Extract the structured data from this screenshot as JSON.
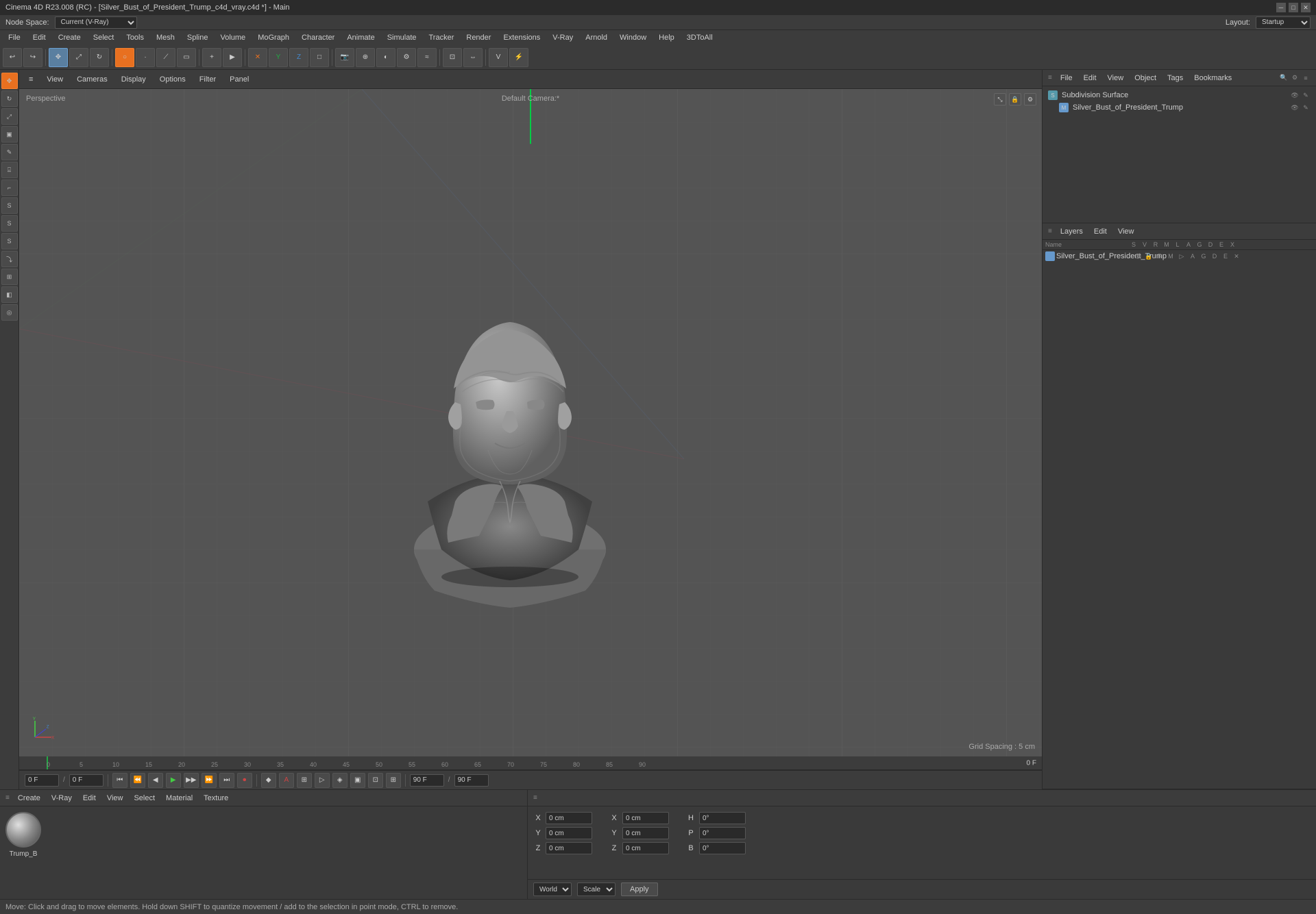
{
  "titlebar": {
    "title": "Cinema 4D R23.008 (RC) - [Silver_Bust_of_President_Trump_c4d_vray.c4d *] - Main",
    "minimize": "─",
    "maximize": "□",
    "close": "✕"
  },
  "menubar": {
    "items": [
      "File",
      "Edit",
      "Create",
      "Select",
      "Tools",
      "Mesh",
      "Spline",
      "Volume",
      "MoGraph",
      "Character",
      "Animate",
      "Simulate",
      "Tracker",
      "Render",
      "Extensions",
      "V-Ray",
      "Arnold",
      "Window",
      "Help",
      "3DToAll"
    ]
  },
  "nodespace": {
    "label": "Node Space:",
    "value": "Current (V-Ray)",
    "layout_label": "Layout:",
    "layout_value": "Startup"
  },
  "object_manager": {
    "header_menus": [
      "File",
      "Edit",
      "View",
      "Object",
      "Tags",
      "Bookmarks"
    ],
    "items": [
      {
        "name": "Subdivision Surface",
        "icon": "S",
        "color": "#6a8fa0"
      },
      {
        "name": "Silver_Bust_of_President_Trump",
        "icon": "M",
        "color": "#6699cc",
        "indent": 1
      }
    ]
  },
  "viewport": {
    "perspective_label": "Perspective",
    "camera_label": "Default Camera:*",
    "grid_spacing": "Grid Spacing : 5 cm",
    "header_menus": [
      "≡",
      "View",
      "Cameras",
      "Display",
      "Options",
      "Filter",
      "Panel"
    ]
  },
  "layers": {
    "header_menus": [
      "Layers",
      "Edit",
      "View"
    ],
    "columns": [
      "Name",
      "S",
      "V",
      "R",
      "M",
      "L",
      "A",
      "G",
      "D",
      "E",
      "X"
    ],
    "items": [
      {
        "name": "Silver_Bust_of_President_Trump",
        "color": "#6699cc"
      }
    ]
  },
  "timeline": {
    "ticks": [
      0,
      5,
      10,
      15,
      20,
      25,
      30,
      35,
      40,
      45,
      50,
      55,
      60,
      65,
      70,
      75,
      80,
      85,
      90
    ],
    "current_frame": "0 F",
    "start_frame": "0 F",
    "end_frame": "90 F",
    "max_frame": "90 F",
    "right_frame": "90 F",
    "frame_indicator": "0 F"
  },
  "timeline_controls": {
    "buttons": [
      "⏮",
      "⏪",
      "◀",
      "▶",
      "▶▶",
      "⏩",
      "⏭",
      "⏺"
    ],
    "start": "0 F",
    "end": "90 F"
  },
  "material_panel": {
    "header_menus": [
      "≡",
      "Create",
      "V-Ray",
      "Edit",
      "View",
      "Select",
      "Material",
      "Texture"
    ],
    "items": [
      {
        "name": "Trump_B",
        "type": "sphere"
      }
    ]
  },
  "coords_panel": {
    "x_pos": "0 cm",
    "y_pos": "0 cm",
    "z_pos": "0 cm",
    "x_rot": "0 cm",
    "y_rot": "0 cm",
    "z_rot": "0 cm",
    "h_val": "0°",
    "p_val": "0°",
    "b_val": "0°",
    "coord_system": "World",
    "transform_type": "Scale",
    "apply_label": "Apply"
  },
  "status_bar": {
    "message": "Move: Click and drag to move elements. Hold down SHIFT to quantize movement / add to the selection in point mode, CTRL to remove."
  },
  "toolbar_icons": {
    "undo": "↩",
    "redo": "↪",
    "move": "✥",
    "scale": "⤢",
    "rotate": "↻",
    "select": "⊹",
    "live": "L",
    "render_region": "□",
    "ipr": "IPR"
  }
}
